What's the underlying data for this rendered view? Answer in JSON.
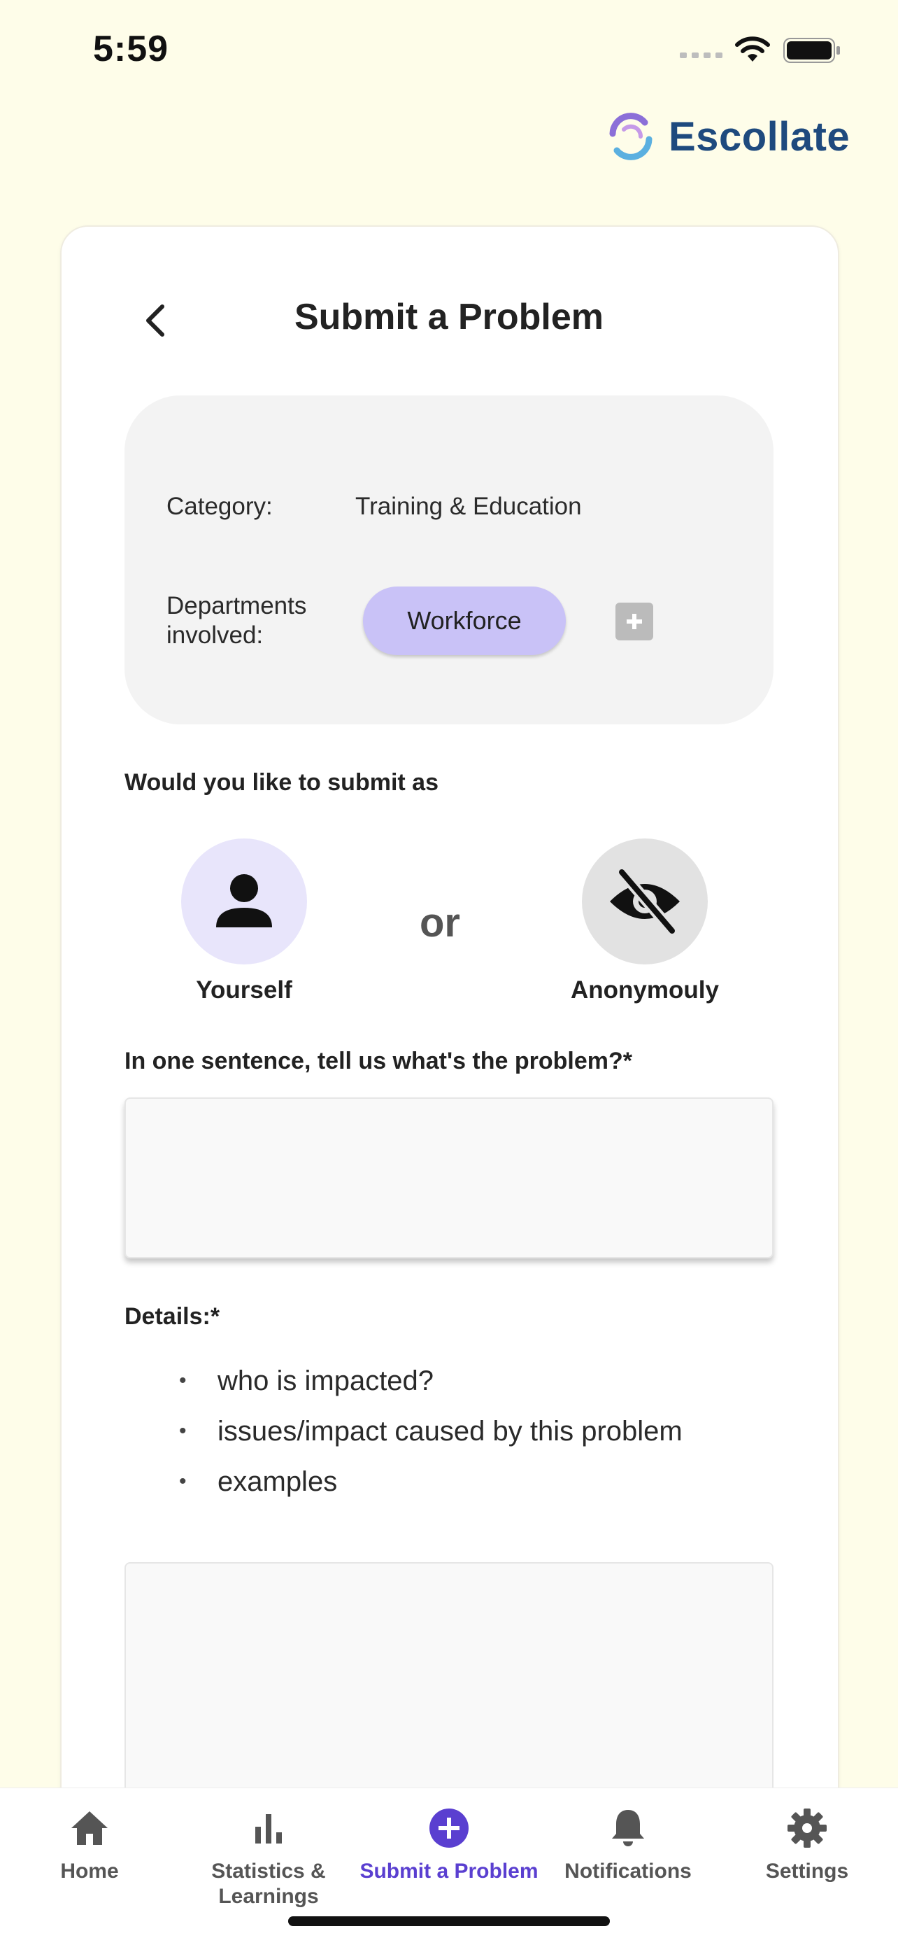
{
  "status_bar": {
    "time": "5:59"
  },
  "brand": {
    "name": "Escollate"
  },
  "header": {
    "title": "Submit a Problem"
  },
  "info": {
    "category_label": "Category:",
    "category_value": "Training & Education",
    "departments_label": "Departments involved:",
    "departments": [
      "Workforce"
    ]
  },
  "submit_as": {
    "question": "Would you like to submit as",
    "yourself_label": "Yourself",
    "or_label": "or",
    "anonymous_label": "Anonymouly"
  },
  "problem": {
    "question": "In one sentence, tell us what's the problem?*",
    "value": ""
  },
  "details": {
    "label": "Details:*",
    "hints": [
      "who is impacted?",
      "issues/impact caused by this problem",
      "examples"
    ],
    "value": ""
  },
  "tabs": [
    {
      "label": "Home",
      "icon": "home-icon"
    },
    {
      "label": "Statistics & Learnings",
      "icon": "bar-chart-icon"
    },
    {
      "label": "Submit a Problem",
      "icon": "add-circle-icon",
      "active": true
    },
    {
      "label": "Notifications",
      "icon": "bell-icon"
    },
    {
      "label": "Settings",
      "icon": "gear-icon"
    }
  ],
  "colors": {
    "background": "#fefde9",
    "accent": "#5a3fd0",
    "chip": "#c9c2f7",
    "brand": "#1e4a7e"
  }
}
